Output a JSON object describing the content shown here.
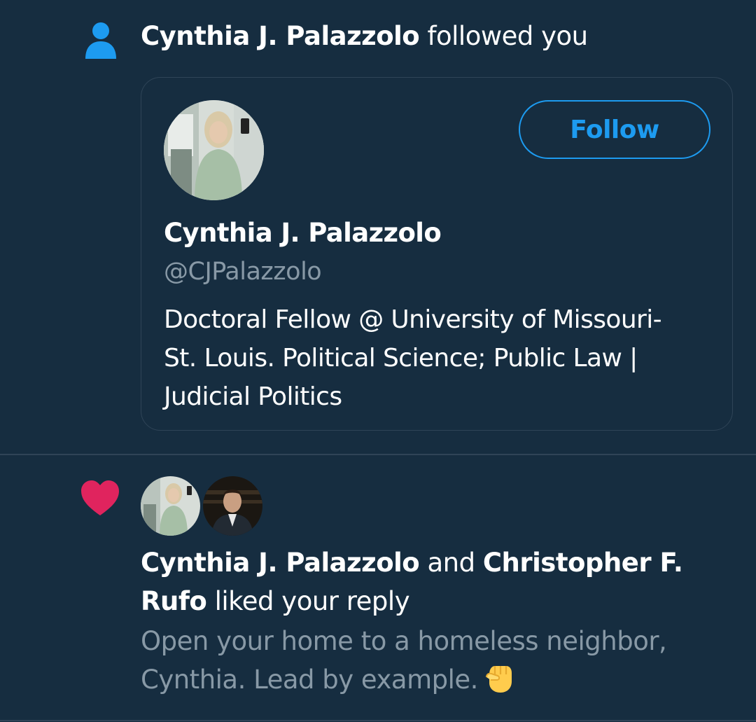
{
  "follow_notification": {
    "actor_name": "Cynthia J. Palazzolo",
    "action_text": "followed you",
    "icon": "person-icon",
    "card": {
      "name": "Cynthia J. Palazzolo",
      "handle": "@CJPalazzolo",
      "bio": "Doctoral Fellow @ University of Missouri-St. Louis. Political Science; Public Law | Judicial Politics",
      "follow_label": "Follow"
    }
  },
  "like_notification": {
    "icon": "heart-icon",
    "actor_1": "Cynthia J. Palazzolo",
    "connector": "and",
    "actor_2": "Christopher F. Rufo",
    "action_text": "liked your reply",
    "reply_text": "Open your home to a homeless neighbor, Cynthia. Lead by example.",
    "reply_emoji": "raised-fist-emoji"
  },
  "colors": {
    "background": "#162d40",
    "accent": "#1d9bf0",
    "heart": "#e0245e",
    "secondary_text": "#8899a6"
  }
}
